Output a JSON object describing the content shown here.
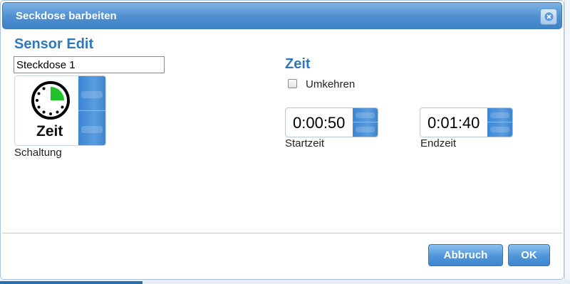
{
  "dialog": {
    "title": "Seckdose barbeiten"
  },
  "sensor": {
    "heading": "Sensor Edit",
    "name_value": "Steckdose 1",
    "schaltung_tile_text": "Zeit",
    "schaltung_label": "Schaltung"
  },
  "zeit": {
    "heading": "Zeit",
    "umkehren_label": "Umkehren",
    "umkehren_checked": false,
    "startzeit_value": "0:00:50",
    "startzeit_label": "Startzeit",
    "endzeit_value": "0:01:40",
    "endzeit_label": "Endzeit"
  },
  "buttons": {
    "cancel": "Abbruch",
    "ok": "OK"
  },
  "colors": {
    "accent": "#2f78bc",
    "titlebar": "#4e8fd0",
    "button": "#4f95d8",
    "clock_segment": "#22c22a"
  },
  "icons": {
    "close": "close-icon",
    "timer": "timer-clock-icon"
  }
}
